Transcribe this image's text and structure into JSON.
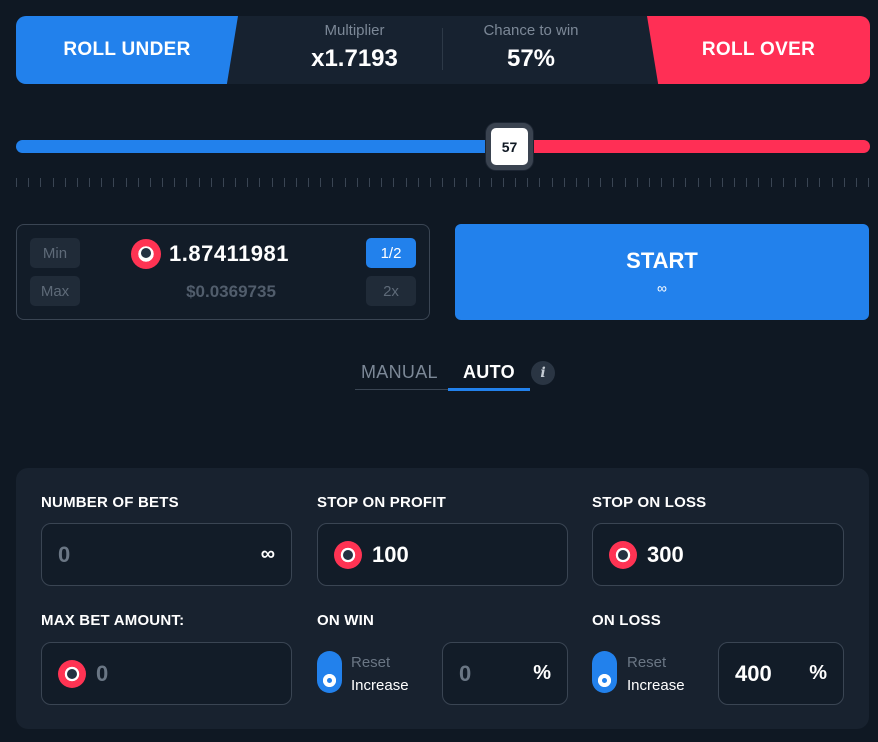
{
  "header": {
    "roll_under": "ROLL UNDER",
    "roll_over": "ROLL OVER",
    "multiplier_label": "Multiplier",
    "multiplier_value": "x1.7193",
    "chance_label": "Chance to win",
    "chance_value": "57%"
  },
  "slider": {
    "value": "57",
    "level_percent": 57
  },
  "bet": {
    "min_label": "Min",
    "max_label": "Max",
    "half_label": "1/2",
    "double_label": "2x",
    "amount": "1.87411981",
    "usd_value": "$0.0369735",
    "coin_icon": "bfg-coin-icon"
  },
  "start": {
    "label": "START",
    "sub": "∞"
  },
  "tabs": {
    "manual": "MANUAL",
    "auto": "AUTO",
    "info": "i",
    "active": "auto"
  },
  "auto": {
    "number_of_bets_label": "NUMBER OF BETS",
    "number_of_bets_value": "0",
    "number_of_bets_suffix": "∞",
    "stop_on_profit_label": "STOP ON PROFIT",
    "stop_on_profit_value": "100",
    "stop_on_loss_label": "STOP ON LOSS",
    "stop_on_loss_value": "300",
    "max_bet_label": "MAX BET AMOUNT:",
    "max_bet_value": "0",
    "on_win_label": "ON WIN",
    "on_win_reset": "Reset",
    "on_win_increase": "Increase",
    "on_win_value": "0",
    "on_win_suffix": "%",
    "on_loss_label": "ON LOSS",
    "on_loss_reset": "Reset",
    "on_loss_increase": "Increase",
    "on_loss_value": "400",
    "on_loss_suffix": "%"
  },
  "colors": {
    "background": "#0f1823",
    "blue": "#2281ec",
    "red": "#ff2f55",
    "panel": "#18222f"
  }
}
